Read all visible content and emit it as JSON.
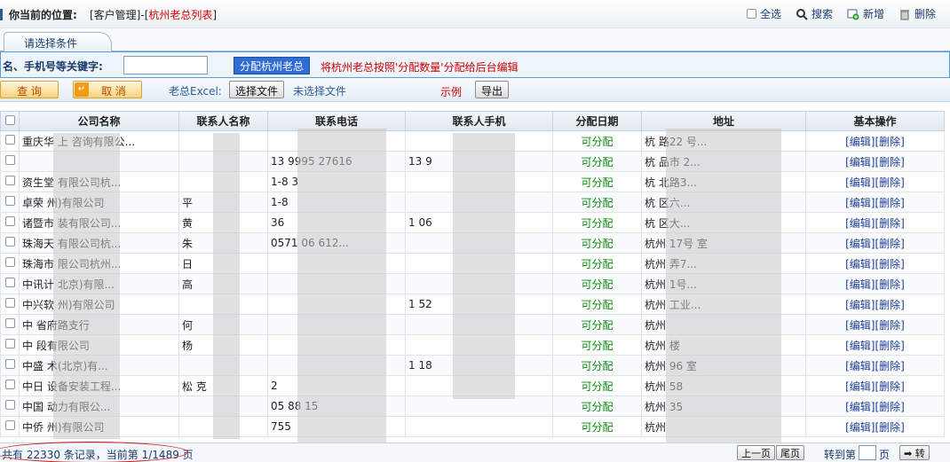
{
  "header": {
    "location_label": "你当前的位置:",
    "crumb_prefix": "[客户管理]-[",
    "crumb_current": "杭州老总列表",
    "crumb_suffix": "]",
    "select_all": "全选",
    "search": "搜索",
    "add": "新增",
    "delete": "删除"
  },
  "tab": {
    "label": "请选择条件"
  },
  "filter": {
    "label": "名、手机号等关键字:",
    "input_value": "",
    "assign_button": "分配杭州老总",
    "note": "将杭州老总按照'分配数量'分配给后台编辑"
  },
  "actions": {
    "query": "查 询",
    "cancel": "取 消",
    "excel_label": "老总Excel:",
    "choose_file": "选择文件",
    "no_file": "未选择文件",
    "example": "示例",
    "export": "导出"
  },
  "table": {
    "columns": [
      "公司名称",
      "联系人名称",
      "联系电话",
      "联系人手机",
      "分配日期",
      "地址",
      "基本操作"
    ],
    "rows": [
      {
        "company": "重庆华   上  咨询有限公...",
        "contact": "",
        "phone": "",
        "mobile": "",
        "date": "可分配",
        "address": "杭     路22   号..."
      },
      {
        "company": "",
        "contact": "",
        "phone": "13     9995     27616",
        "mobile": "13     9",
        "date": "可分配",
        "address": "杭     品市   2..."
      },
      {
        "company": "资生堂     有限公司杭...",
        "contact": "",
        "phone": "1-8     3",
        "mobile": "",
        "date": "可分配",
        "address": "杭     北路3..."
      },
      {
        "company": "卓荣     州)有限公司",
        "contact": "平",
        "phone": "1-8",
        "mobile": "",
        "date": "可分配",
        "address": "杭     区六..."
      },
      {
        "company": "诸暨市     装有限公司...",
        "contact": "黄",
        "phone": "36",
        "mobile": "1     06",
        "date": "可分配",
        "address": "杭     区大..."
      },
      {
        "company": "珠海天     有限公司杭...",
        "contact": "朱",
        "phone": "0571     06     612...",
        "mobile": "",
        "date": "可分配",
        "address": "杭州     17号     室"
      },
      {
        "company": "珠海市     限公司杭州...",
        "contact": "日",
        "phone": "",
        "mobile": "",
        "date": "可分配",
        "address": "杭州     弄7..."
      },
      {
        "company": "中讯计     北京)有限...",
        "contact": "高",
        "phone": "",
        "mobile": "",
        "date": "可分配",
        "address": "杭州     1号..."
      },
      {
        "company": "中兴软     州)有限公司",
        "contact": "",
        "phone": "",
        "mobile": "1     52",
        "date": "可分配",
        "address": "杭州     工业..."
      },
      {
        "company": "中     省府路支行",
        "contact": "何",
        "phone": "",
        "mobile": "",
        "date": "可分配",
        "address": "杭州"
      },
      {
        "company": "中     段有限公司",
        "contact": "杨",
        "phone": "",
        "mobile": "",
        "date": "可分配",
        "address": "杭州     楼"
      },
      {
        "company": "中盛     术(北京)有...",
        "contact": "",
        "phone": "",
        "mobile": "1     18",
        "date": "可分配",
        "address": "杭州     96     室"
      },
      {
        "company": "中日     设备安装工程...",
        "contact": "松     克",
        "phone": "2",
        "mobile": "",
        "date": "可分配",
        "address": "杭州     58"
      },
      {
        "company": "中国     动力有限公...",
        "contact": "",
        "phone": "05     88     15",
        "mobile": "",
        "date": "可分配",
        "address": "杭州     35"
      },
      {
        "company": "中侨     州)有限公司",
        "contact": "",
        "phone": "755",
        "mobile": "",
        "date": "可分配",
        "address": "杭州"
      }
    ],
    "edit_label": "[编辑]",
    "delete_label": "[删除]"
  },
  "footer": {
    "total_text": "共有 22330 条记录，当前第 1/1489 页",
    "prev": "上一页",
    "last": "尾页",
    "goto_label": "转到第",
    "page_unit": "页",
    "go": "转"
  }
}
